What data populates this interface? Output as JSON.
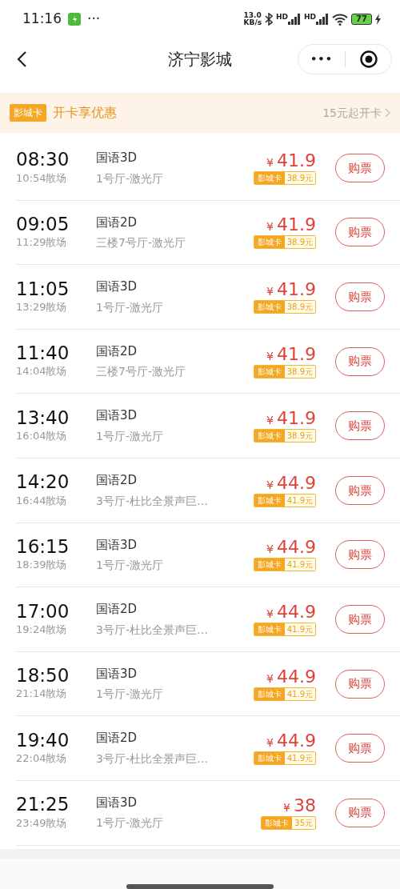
{
  "status_bar": {
    "time": "11:16",
    "more": "···",
    "speed": "13.0",
    "speed_unit": "KB/s",
    "signal_label_1": "HD",
    "signal_label_2": "HD",
    "battery": "77"
  },
  "nav": {
    "title": "济宁影城",
    "more": "•••"
  },
  "promo": {
    "badge": "影城卡",
    "text": "开卡享优惠",
    "link": "15元起开卡"
  },
  "showtimes": [
    {
      "start": "08:30",
      "end": "10:54散场",
      "format": "国语3D",
      "hall": "1号厅-激光厅",
      "currency": "¥",
      "price": "41.9",
      "card_label": "影城卡",
      "card_price": "38.9元",
      "button": "购票"
    },
    {
      "start": "09:05",
      "end": "11:29散场",
      "format": "国语2D",
      "hall": "三楼7号厅-激光厅",
      "currency": "¥",
      "price": "41.9",
      "card_label": "影城卡",
      "card_price": "38.9元",
      "button": "购票"
    },
    {
      "start": "11:05",
      "end": "13:29散场",
      "format": "国语3D",
      "hall": "1号厅-激光厅",
      "currency": "¥",
      "price": "41.9",
      "card_label": "影城卡",
      "card_price": "38.9元",
      "button": "购票"
    },
    {
      "start": "11:40",
      "end": "14:04散场",
      "format": "国语2D",
      "hall": "三楼7号厅-激光厅",
      "currency": "¥",
      "price": "41.9",
      "card_label": "影城卡",
      "card_price": "38.9元",
      "button": "购票"
    },
    {
      "start": "13:40",
      "end": "16:04散场",
      "format": "国语3D",
      "hall": "1号厅-激光厅",
      "currency": "¥",
      "price": "41.9",
      "card_label": "影城卡",
      "card_price": "38.9元",
      "button": "购票"
    },
    {
      "start": "14:20",
      "end": "16:44散场",
      "format": "国语2D",
      "hall": "3号厅-杜比全景声巨…",
      "currency": "¥",
      "price": "44.9",
      "card_label": "影城卡",
      "card_price": "41.9元",
      "button": "购票"
    },
    {
      "start": "16:15",
      "end": "18:39散场",
      "format": "国语3D",
      "hall": "1号厅-激光厅",
      "currency": "¥",
      "price": "44.9",
      "card_label": "影城卡",
      "card_price": "41.9元",
      "button": "购票"
    },
    {
      "start": "17:00",
      "end": "19:24散场",
      "format": "国语2D",
      "hall": "3号厅-杜比全景声巨…",
      "currency": "¥",
      "price": "44.9",
      "card_label": "影城卡",
      "card_price": "41.9元",
      "button": "购票"
    },
    {
      "start": "18:50",
      "end": "21:14散场",
      "format": "国语3D",
      "hall": "1号厅-激光厅",
      "currency": "¥",
      "price": "44.9",
      "card_label": "影城卡",
      "card_price": "41.9元",
      "button": "购票"
    },
    {
      "start": "19:40",
      "end": "22:04散场",
      "format": "国语2D",
      "hall": "3号厅-杜比全景声巨…",
      "currency": "¥",
      "price": "44.9",
      "card_label": "影城卡",
      "card_price": "41.9元",
      "button": "购票"
    },
    {
      "start": "21:25",
      "end": "23:49散场",
      "format": "国语3D",
      "hall": "1号厅-激光厅",
      "currency": "¥",
      "price": "38",
      "card_label": "影城卡",
      "card_price": "35元",
      "button": "购票"
    }
  ]
}
